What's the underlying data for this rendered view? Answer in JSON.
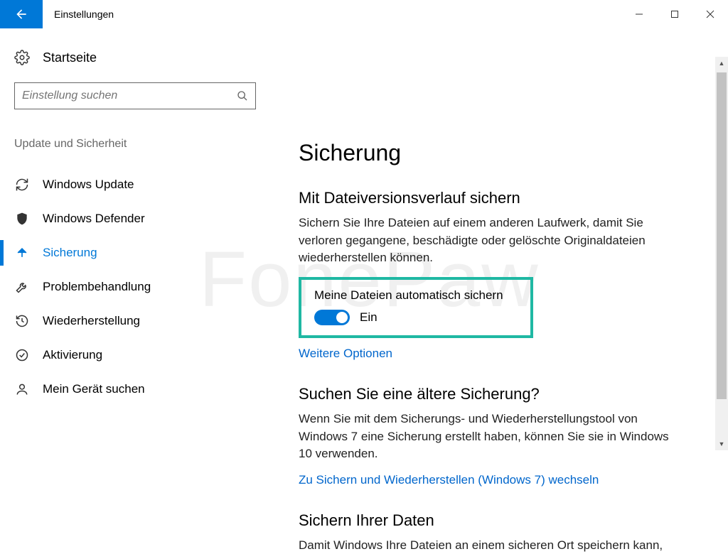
{
  "window": {
    "title": "Einstellungen"
  },
  "sidebar": {
    "home": "Startseite",
    "search_placeholder": "Einstellung suchen",
    "category": "Update und Sicherheit",
    "items": [
      {
        "label": "Windows Update",
        "icon": "sync"
      },
      {
        "label": "Windows Defender",
        "icon": "shield"
      },
      {
        "label": "Sicherung",
        "icon": "backup-arrow",
        "active": true
      },
      {
        "label": "Problembehandlung",
        "icon": "wrench"
      },
      {
        "label": "Wiederherstellung",
        "icon": "history"
      },
      {
        "label": "Aktivierung",
        "icon": "check-circle"
      },
      {
        "label": "Mein Gerät suchen",
        "icon": "find-device"
      }
    ]
  },
  "main": {
    "heading": "Sicherung",
    "section1": {
      "title": "Mit Dateiversionsverlauf sichern",
      "desc": "Sichern Sie Ihre Dateien auf einem anderen Laufwerk, damit Sie verloren gegangene, beschädigte oder gelöschte Originaldateien wiederherstellen können.",
      "toggle_label": "Meine Dateien automatisch sichern",
      "toggle_state": "Ein",
      "link": "Weitere Optionen"
    },
    "section2": {
      "title": "Suchen Sie eine ältere Sicherung?",
      "desc": "Wenn Sie mit dem Sicherungs- und Wiederherstellungstool von Windows 7 eine Sicherung erstellt haben, können Sie sie in Windows 10 verwenden.",
      "link": "Zu Sichern und Wiederherstellen (Windows 7) wechseln"
    },
    "section3": {
      "title": "Sichern Ihrer Daten",
      "desc": "Damit Windows Ihre Dateien an einem sicheren Ort speichern kann,"
    }
  },
  "watermark": "FonePaw"
}
